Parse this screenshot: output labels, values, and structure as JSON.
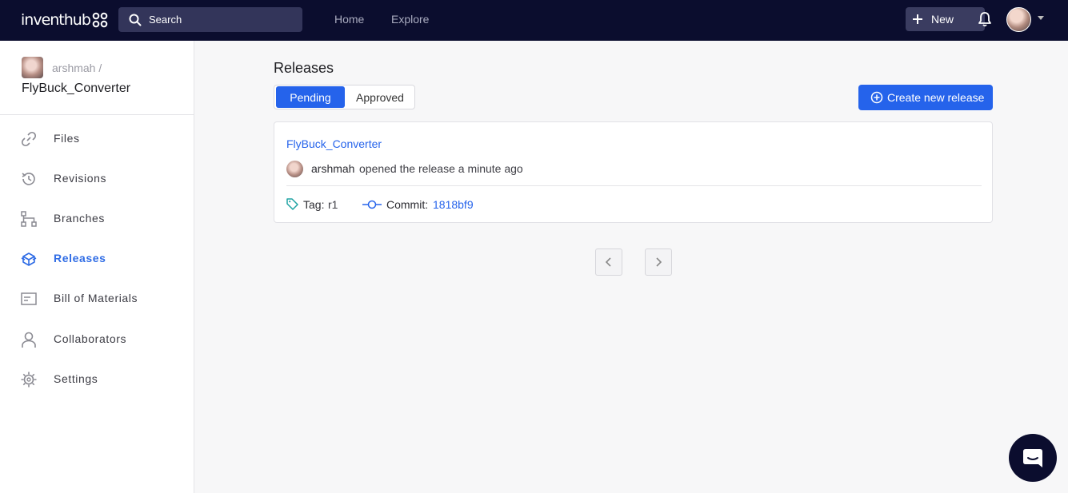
{
  "topbar": {
    "logo_text": "inventhub",
    "search_placeholder": "Search",
    "nav": [
      "Home",
      "Explore"
    ],
    "new_label": "New"
  },
  "repo": {
    "owner": "arshmah /",
    "name": "FlyBuck_Converter"
  },
  "sidebar": {
    "items": [
      {
        "label": "Files",
        "icon": "link-icon"
      },
      {
        "label": "Revisions",
        "icon": "history-icon"
      },
      {
        "label": "Branches",
        "icon": "branches-icon"
      },
      {
        "label": "Releases",
        "icon": "release-box-icon",
        "active": true
      },
      {
        "label": "Bill of Materials",
        "icon": "bom-list-icon"
      },
      {
        "label": "Collaborators",
        "icon": "user-icon"
      },
      {
        "label": "Settings",
        "icon": "gear-icon"
      }
    ]
  },
  "main": {
    "title": "Releases",
    "tabs": [
      "Pending",
      "Approved"
    ],
    "active_tab": "Pending",
    "create_label": "Create new release",
    "release": {
      "name": "FlyBuck_Converter",
      "user": "arshmah",
      "activity": "opened the release a minute ago",
      "tag_label": "Tag:",
      "tag": "r1",
      "commit_label": "Commit:",
      "commit": "1818bf9"
    }
  },
  "colors": {
    "navbar": "#0b0d2e",
    "accent": "#2563eb"
  }
}
